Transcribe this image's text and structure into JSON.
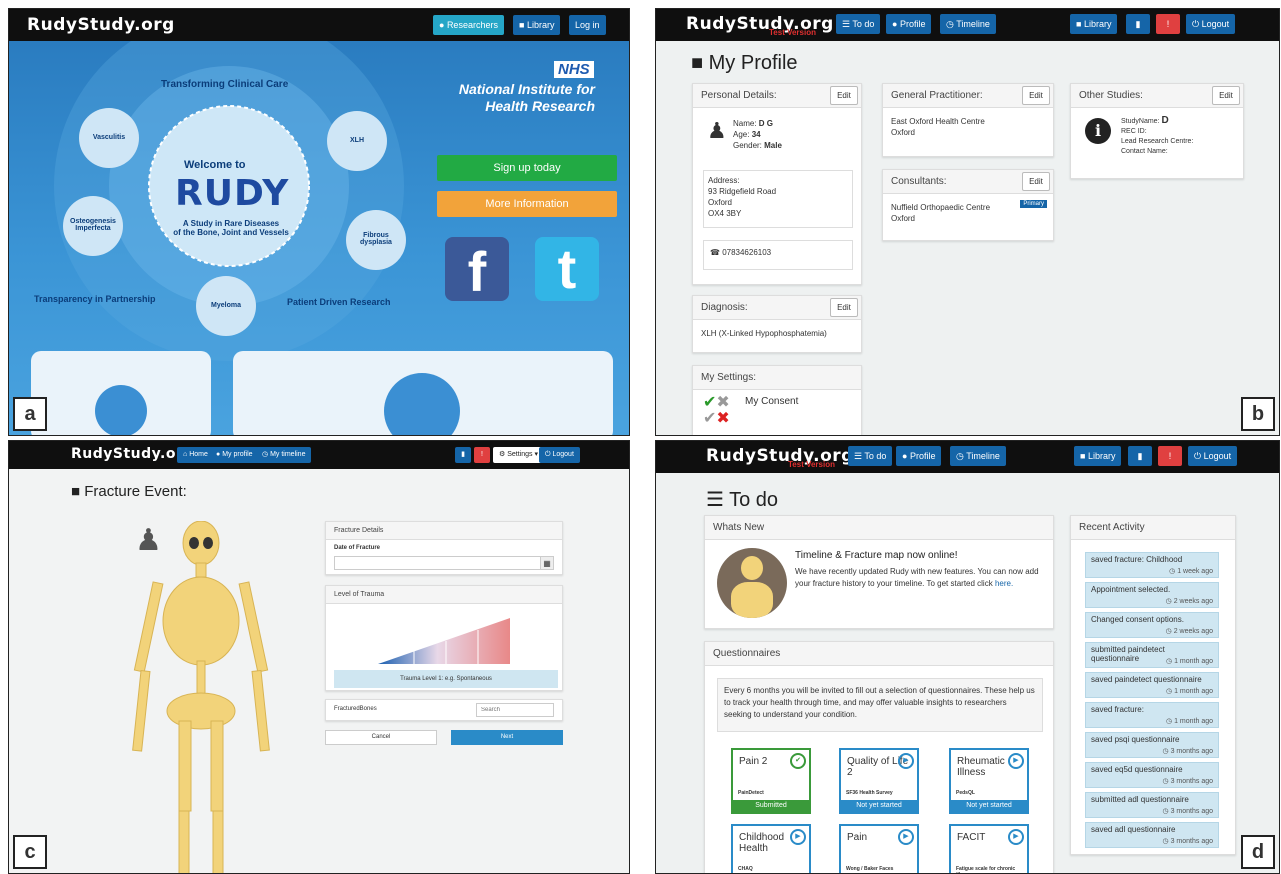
{
  "panel_labels": {
    "a": "a",
    "b": "b",
    "c": "c",
    "d": "d"
  },
  "a": {
    "logo": "RudyStudy.org",
    "nav": {
      "researchers": "Researchers",
      "library": "Library",
      "login": "Log in"
    },
    "hero": {
      "transforming": "Transforming Clinical Care",
      "welcome": "Welcome to",
      "rudy": "RUDY",
      "tagline1": "A Study in Rare Diseases",
      "tagline2": "of the Bone, Joint and Vessels",
      "transparency": "Transparency in Partnership",
      "patient_driven": "Patient Driven Research",
      "circles": [
        "Vasculitis",
        "XLH",
        "Osteogenesis Imperfecta",
        "Fibrous dysplasia",
        "Myeloma"
      ]
    },
    "nhs": {
      "badge": "NHS",
      "line1": "National Institute for",
      "line2": "Health Research"
    },
    "signup": "Sign up today",
    "more_info": "More Information",
    "facebook": "f",
    "twitter": "t"
  },
  "b": {
    "logo": "RudyStudy.org",
    "test_version": "Test Version",
    "nav": {
      "todo": "To do",
      "profile": "Profile",
      "timeline": "Timeline",
      "library": "Library",
      "logout": "Logout"
    },
    "title": "My Profile",
    "edit": "Edit",
    "personal": {
      "header": "Personal Details:",
      "name_label": "Name:",
      "name": "D G",
      "age_label": "Age:",
      "age": "34",
      "gender_label": "Gender:",
      "gender": "Male",
      "address_label": "Address:",
      "address1": "93 Ridgefield Road",
      "address2": "Oxford",
      "address3": "OX4 3BY",
      "phone": "07834626103"
    },
    "gp": {
      "header": "General Practitioner:",
      "line1": "East Oxford Health Centre",
      "line2": "Oxford"
    },
    "consultants": {
      "header": "Consultants:",
      "line1": "Nuffield Orthopaedic Centre",
      "line2": "Oxford",
      "badge": "Primary"
    },
    "other": {
      "header": "Other Studies:",
      "study_label": "StudyName:",
      "study": "D",
      "rec": "REC ID:",
      "lead": "Lead Research Centre:",
      "contact": "Contact Name:"
    },
    "diagnosis": {
      "header": "Diagnosis:",
      "value": "XLH (X-Linked Hypophosphatemia)"
    },
    "settings": {
      "header": "My Settings:",
      "consent": "My Consent"
    }
  },
  "c": {
    "logo": "RudyStudy.org",
    "nav": {
      "home": "Home",
      "profile": "My profile",
      "timeline": "My timeline",
      "settings": "Settings",
      "logout": "Logout"
    },
    "title": "Fracture Event:",
    "fracture_details": "Fracture Details",
    "date_label": "Date of Fracture",
    "trauma_header": "Level of Trauma",
    "trauma_level": "Trauma Level 1: e.g. Spontaneous",
    "fractured_bones": "FracturedBones",
    "search_placeholder": "Search",
    "cancel": "Cancel",
    "next": "Next"
  },
  "d": {
    "logo": "RudyStudy.org",
    "test_version": "Test Version",
    "nav": {
      "todo": "To do",
      "profile": "Profile",
      "timeline": "Timeline",
      "library": "Library",
      "logout": "Logout"
    },
    "title": "To do",
    "whats_new": {
      "header": "Whats New",
      "heading": "Timeline & Fracture map now online!",
      "body": "We have recently updated Rudy with new features. You can now add your fracture history to your timeline. To get started click",
      "link": "here."
    },
    "questionnaires": {
      "header": "Questionnaires",
      "intro": "Every 6 months you will be invited to fill out a selection of questionnaires. These help us to track your health through time, and may offer valuable insights to researchers seeking to understand your condition.",
      "cards": [
        {
          "title": "Pain 2",
          "sub": "PainDetect",
          "status": "Submitted",
          "color": "#3a9a3a"
        },
        {
          "title": "Quality of Life 2",
          "sub": "SF36 Health Survey",
          "status": "Not yet started",
          "color": "#2a8bc8"
        },
        {
          "title": "Rheumatic Illness",
          "sub": "PedsQL",
          "status": "Not yet started",
          "color": "#2a8bc8"
        },
        {
          "title": "Childhood Health",
          "sub": "CHAQ",
          "status": "",
          "color": "#2a8bc8"
        },
        {
          "title": "Pain",
          "sub": "Wong / Baker Faces",
          "status": "",
          "color": "#2a8bc8"
        },
        {
          "title": "FACIT",
          "sub": "Fatigue scale for chronic illness",
          "status": "",
          "color": "#2a8bc8"
        }
      ]
    },
    "recent": {
      "header": "Recent Activity",
      "items": [
        {
          "text": "saved fracture: Childhood",
          "time": "1 week ago"
        },
        {
          "text": "Appointment selected.",
          "time": "2 weeks ago"
        },
        {
          "text": "Changed consent options.",
          "time": "2 weeks ago"
        },
        {
          "text": "submitted paindetect questionnaire",
          "time": "1 month ago"
        },
        {
          "text": "saved paindetect questionnaire",
          "time": "1 month ago"
        },
        {
          "text": "saved fracture:",
          "time": "1 month ago"
        },
        {
          "text": "saved psqi questionnaire",
          "time": "3 months ago"
        },
        {
          "text": "saved eq5d questionnaire",
          "time": "3 months ago"
        },
        {
          "text": "submitted adl questionnaire",
          "time": "3 months ago"
        },
        {
          "text": "saved adl questionnaire",
          "time": "3 months ago"
        }
      ]
    }
  }
}
